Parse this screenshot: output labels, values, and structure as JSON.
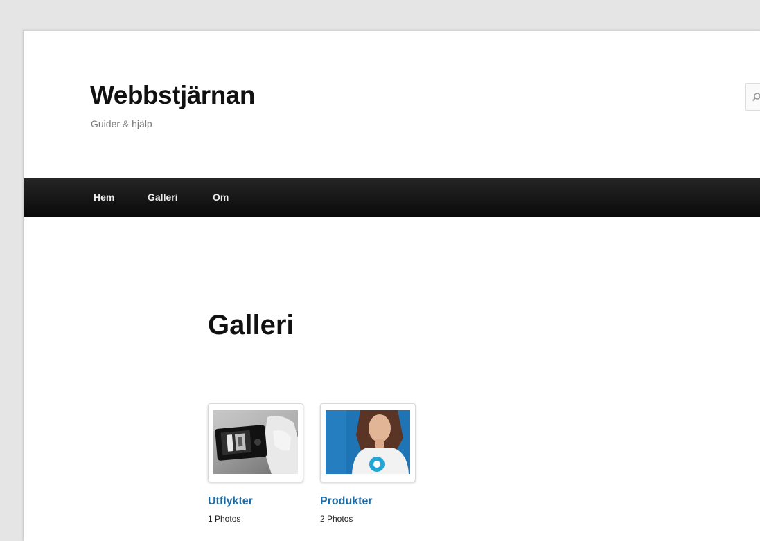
{
  "site": {
    "title": "Webbstjärnan",
    "description": "Guider & hjälp"
  },
  "search": {
    "icon": "search-icon"
  },
  "nav": {
    "items": [
      {
        "label": "Hem"
      },
      {
        "label": "Galleri"
      },
      {
        "label": "Om"
      }
    ]
  },
  "main": {
    "heading": "Galleri",
    "albums": [
      {
        "title": "Utflykter",
        "count": "1 Photos",
        "thumbnail": "phone-camera-photo"
      },
      {
        "title": "Produkter",
        "count": "2 Photos",
        "thumbnail": "woman-with-logo-photo"
      }
    ]
  },
  "colors": {
    "nav_background": "#111111",
    "link": "#1b6ba8",
    "page_background": "#ffffff",
    "outer_background": "#e5e5e5"
  }
}
